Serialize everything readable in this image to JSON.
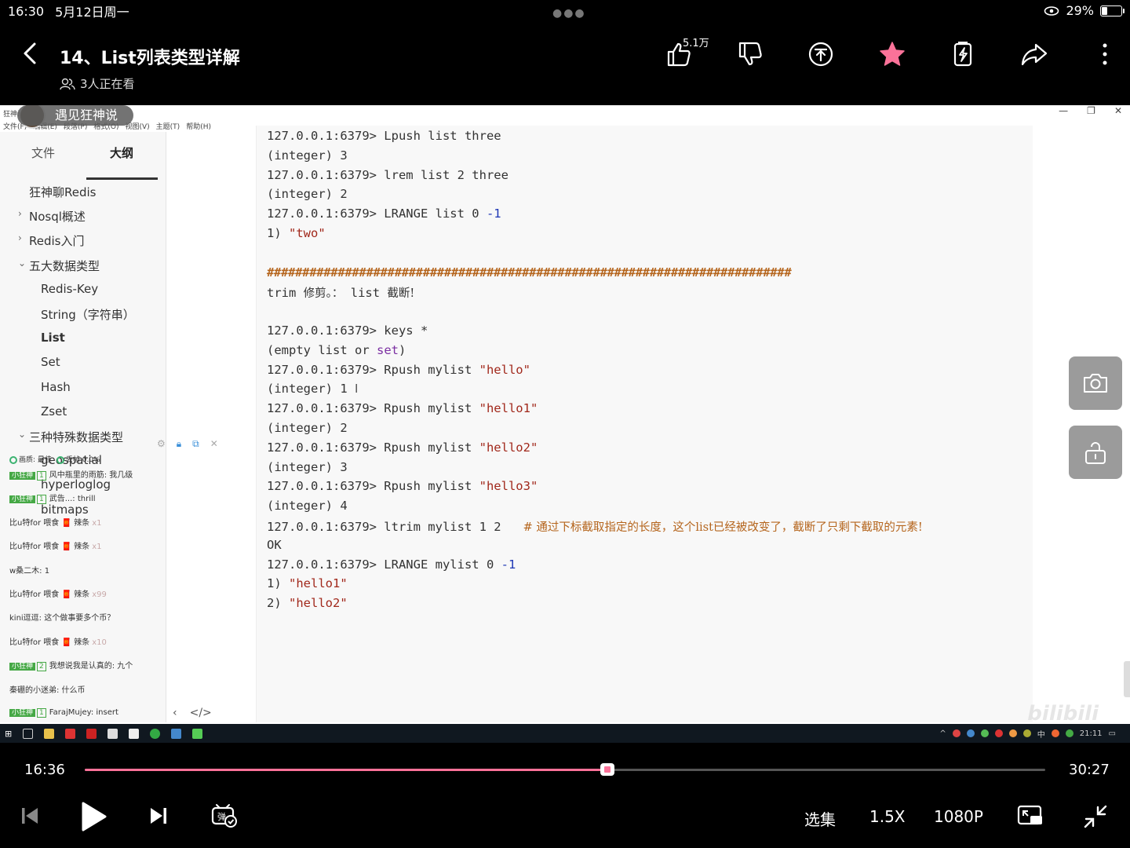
{
  "status": {
    "time": "16:30",
    "date": "5月12日周一",
    "battery": "29%",
    "battery_fraction": 0.29
  },
  "header": {
    "title": "14、List列表类型详解",
    "watching": "3人正在看",
    "like_count": "5.1万"
  },
  "video": {
    "window_title": "狂神说",
    "menu": [
      "文件(F)",
      "编辑(E)",
      "段落(P)",
      "格式(O)",
      "视图(V)",
      "主题(T)",
      "帮助(H)"
    ],
    "uploader": "遇见狂神说",
    "sidebar": {
      "tabs": [
        "文件",
        "大纲"
      ],
      "outline": [
        {
          "label": "狂神聊Redis",
          "level": 0,
          "arrow": ""
        },
        {
          "label": "Nosql概述",
          "level": 0,
          "arrow": "›"
        },
        {
          "label": "Redis入门",
          "level": 0,
          "arrow": "›"
        },
        {
          "label": "五大数据类型",
          "level": 0,
          "arrow": "⌄"
        },
        {
          "label": "Redis-Key",
          "level": 1,
          "arrow": ""
        },
        {
          "label": "String（字符串）",
          "level": 1,
          "arrow": ""
        },
        {
          "label": "List",
          "level": 1,
          "arrow": "",
          "bold": true
        },
        {
          "label": "Set",
          "level": 1,
          "arrow": ""
        },
        {
          "label": "Hash",
          "level": 1,
          "arrow": ""
        },
        {
          "label": "Zset",
          "level": 1,
          "arrow": ""
        },
        {
          "label": "三种特殊数据类型",
          "level": 0,
          "arrow": "⌄"
        },
        {
          "label": "geospatial",
          "level": 1,
          "arrow": ""
        },
        {
          "label": "hyperloglog",
          "level": 1,
          "arrow": ""
        },
        {
          "label": "bitmaps",
          "level": 1,
          "arrow": ""
        }
      ],
      "stats": {
        "quality": "画质: 最佳",
        "drop": "丢帧 0.0%"
      },
      "chat": [
        {
          "tag": "小狂神",
          "lvl": "1",
          "text": "风中瓶里的雨筋: 我几级"
        },
        {
          "tag": "小狂神",
          "lvl": "1",
          "text": "武告...: thrill"
        },
        {
          "tag": "",
          "lvl": "",
          "text": "比u特for 喂食 🧧 辣条",
          "x": "x1"
        },
        {
          "tag": "",
          "lvl": "",
          "text": "比u特for 喂食 🧧 辣条",
          "x": "x1"
        },
        {
          "tag": "",
          "lvl": "",
          "text": "w桑二木: 1"
        },
        {
          "tag": "",
          "lvl": "",
          "text": "比u特for 喂食 🧧 辣条",
          "x": "x99"
        },
        {
          "tag": "",
          "lvl": "",
          "text": "kini逗逗: 这个做事要多个币？"
        },
        {
          "tag": "",
          "lvl": "",
          "text": "比u特for 喂食 🧧 辣条",
          "x": "x10"
        },
        {
          "tag": "小狂神",
          "lvl": "2",
          "text": "我想说我是认真的: 九个"
        },
        {
          "tag": "",
          "lvl": "",
          "text": "秦硼的小迷弟: 什么币"
        },
        {
          "tag": "小狂神",
          "lvl": "1",
          "text": "FarajMujey: insert"
        }
      ]
    },
    "code": [
      [
        {
          "t": "127.0.0.1:6379> Lpush list three"
        }
      ],
      [
        {
          "t": "(integer) 3"
        }
      ],
      [
        {
          "t": "127.0.0.1:6379> lrem list 2 three"
        }
      ],
      [
        {
          "t": "(integer) 2"
        }
      ],
      [
        {
          "t": "127.0.0.1:6379> LRANGE list 0 "
        },
        {
          "t": "-1",
          "c": "num"
        }
      ],
      [
        {
          "t": "1) "
        },
        {
          "t": "\"two\"",
          "c": "str"
        }
      ],
      [],
      [
        {
          "t": "##########################################################################",
          "c": "hash"
        }
      ],
      [
        {
          "t": "trim "
        },
        {
          "t": "修剪。：",
          "c": "cn"
        },
        {
          "t": " list "
        },
        {
          "t": "截断!",
          "c": "cn"
        }
      ],
      [],
      [
        {
          "t": "127.0.0.1:6379> keys *"
        }
      ],
      [
        {
          "t": "(empty list or "
        },
        {
          "t": "set",
          "c": "kw"
        },
        {
          "t": ")"
        }
      ],
      [
        {
          "t": "127.0.0.1:6379> Rpush mylist "
        },
        {
          "t": "\"hello\"",
          "c": "str"
        }
      ],
      [
        {
          "t": "(integer) 1"
        }
      ],
      [
        {
          "t": "127.0.0.1:6379> Rpush mylist "
        },
        {
          "t": "\"hello1\"",
          "c": "str"
        }
      ],
      [
        {
          "t": "(integer) 2"
        }
      ],
      [
        {
          "t": "127.0.0.1:6379> Rpush mylist "
        },
        {
          "t": "\"hello2\"",
          "c": "str"
        }
      ],
      [
        {
          "t": "(integer) 3"
        }
      ],
      [
        {
          "t": "127.0.0.1:6379> Rpush mylist "
        },
        {
          "t": "\"hello3\"",
          "c": "str"
        }
      ],
      [
        {
          "t": "(integer) 4"
        }
      ],
      [
        {
          "t": "127.0.0.1:6379> ltrim mylist 1 2   "
        },
        {
          "t": "# 通过下标截取指定的长度，这个list已经被改变了，截断了只剩下截取的元素!",
          "c": "cm"
        }
      ],
      [
        {
          "t": "OK"
        }
      ],
      [
        {
          "t": "127.0.0.1:6379> LRANGE mylist 0 "
        },
        {
          "t": "-1",
          "c": "num"
        }
      ],
      [
        {
          "t": "1) "
        },
        {
          "t": "\"hello1\"",
          "c": "str"
        }
      ],
      [
        {
          "t": "2) "
        },
        {
          "t": "\"hello2\"",
          "c": "str"
        }
      ]
    ],
    "taskbar_clock": "21:11",
    "taskbar_ime": "中"
  },
  "player": {
    "current": "16:36",
    "total": "30:27",
    "progress_fraction": 0.544,
    "episodes": "选集",
    "speed": "1.5X",
    "quality": "1080P"
  },
  "colors": {
    "accent": "#fb7299",
    "star": "#fb7299"
  }
}
